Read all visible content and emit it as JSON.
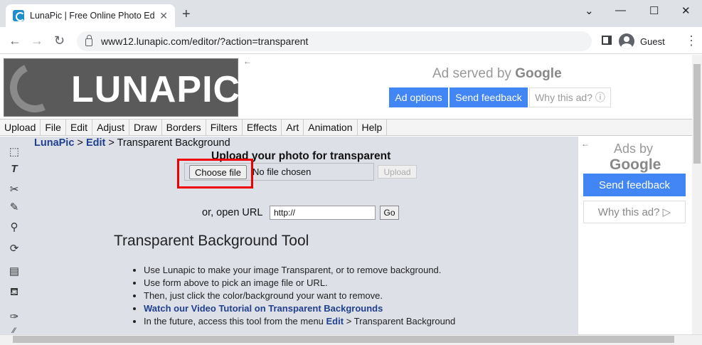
{
  "browser": {
    "tab_title": "LunaPic | Free Online Photo Ed",
    "tab_close": "✕",
    "new_tab": "+",
    "win_min": "⌄",
    "win_min2": "—",
    "win_max": "☐",
    "win_close": "✕",
    "back": "←",
    "forward": "→",
    "reload": "↻",
    "url": "www12.lunapic.com/editor/?action=transparent",
    "profile_name": "Guest",
    "menu_dots": "⋮"
  },
  "header": {
    "logo_text": "LUNAPIC",
    "ad_served_by": "Ad served by",
    "ad_google": "Google",
    "ad_options": "Ad options",
    "send_feedback": "Send feedback",
    "why_this_ad": "Why this ad? ⓘ",
    "ad_arrow": "←"
  },
  "menu": [
    "Upload",
    "File",
    "Edit",
    "Adjust",
    "Draw",
    "Borders",
    "Filters",
    "Effects",
    "Art",
    "Animation",
    "Help"
  ],
  "breadcrumb": {
    "home": "LunaPic",
    "sep1": " > ",
    "section": "Edit",
    "sep2": " > ",
    "current": "Transparent Background"
  },
  "upload": {
    "title": "Upload your photo for transparent",
    "choose_file": "Choose file",
    "no_file": "No file chosen",
    "upload_btn": "Upload",
    "url_label": "or, open URL",
    "url_value": "http://",
    "go_btn": "Go"
  },
  "tool": {
    "heading": "Transparent Background Tool",
    "bullet1": "Use Lunapic to make your image Transparent, or to remove background.",
    "bullet2": "Use form above to pick an image file or URL.",
    "bullet3": "Then, just click the color/background your want to remove.",
    "bullet4": "Watch our Video Tutorial on Transparent Backgrounds",
    "bullet5_pre": "In the future, access this tool from the menu ",
    "bullet5_link": "Edit",
    "bullet5_post": " > Transparent Background"
  },
  "side_ad": {
    "arrow": "←",
    "ads_by": "Ads by",
    "google": "Google",
    "send_feedback": "Send feedback",
    "why_this_ad": "Why this ad? ▷"
  },
  "tools": [
    "⬚",
    "T",
    "✂",
    "✎",
    "⚲",
    "⟳",
    "▤",
    "⛾",
    "✑",
    "⁄⁄"
  ]
}
